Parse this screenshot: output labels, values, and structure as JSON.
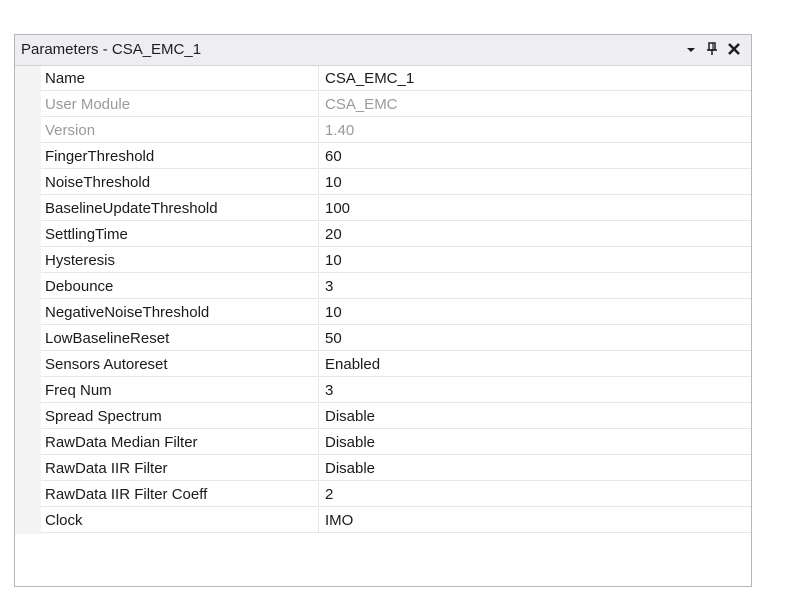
{
  "panel": {
    "title": "Parameters - CSA_EMC_1"
  },
  "properties": [
    {
      "name": "Name",
      "value": "CSA_EMC_1",
      "disabled": false
    },
    {
      "name": "User Module",
      "value": "CSA_EMC",
      "disabled": true
    },
    {
      "name": "Version",
      "value": "1.40",
      "disabled": true
    },
    {
      "name": "FingerThreshold",
      "value": "60",
      "disabled": false
    },
    {
      "name": "NoiseThreshold",
      "value": "10",
      "disabled": false
    },
    {
      "name": "BaselineUpdateThreshold",
      "value": "100",
      "disabled": false
    },
    {
      "name": "SettlingTime",
      "value": "20",
      "disabled": false
    },
    {
      "name": "Hysteresis",
      "value": "10",
      "disabled": false
    },
    {
      "name": "Debounce",
      "value": "3",
      "disabled": false
    },
    {
      "name": "NegativeNoiseThreshold",
      "value": "10",
      "disabled": false
    },
    {
      "name": "LowBaselineReset",
      "value": "50",
      "disabled": false
    },
    {
      "name": "Sensors Autoreset",
      "value": "Enabled",
      "disabled": false
    },
    {
      "name": "Freq Num",
      "value": "3",
      "disabled": false
    },
    {
      "name": "Spread Spectrum",
      "value": "Disable",
      "disabled": false
    },
    {
      "name": "RawData Median Filter",
      "value": "Disable",
      "disabled": false
    },
    {
      "name": "RawData IIR Filter",
      "value": "Disable",
      "disabled": false
    },
    {
      "name": "RawData IIR Filter Coeff",
      "value": "2",
      "disabled": false
    },
    {
      "name": "Clock",
      "value": "IMO",
      "disabled": false
    }
  ]
}
